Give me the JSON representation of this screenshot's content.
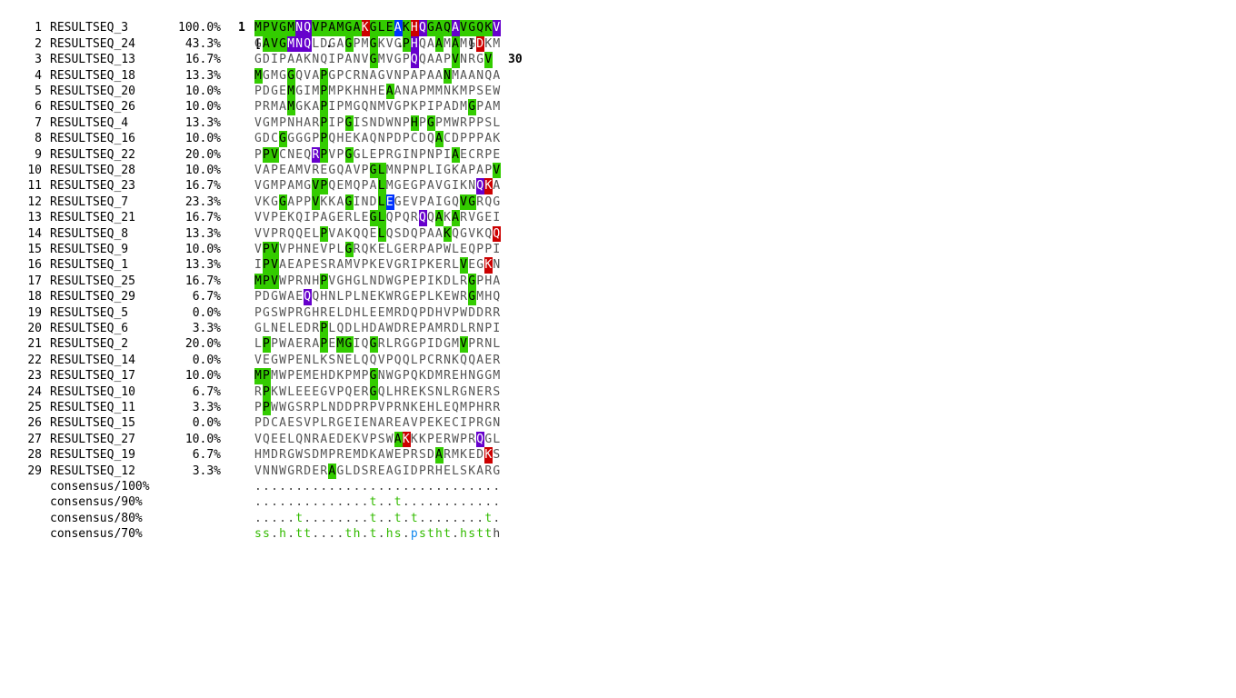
{
  "ruler": {
    "start": "1",
    "marks": "[         .         .         ]",
    "end": "30"
  },
  "colors": {
    "green": "#33cc00",
    "purple": "#6600cc",
    "red": "#cc0000",
    "blue": "#0033ff",
    "consensus_green": "#33bb00",
    "consensus_blue": "#1188ee"
  },
  "rows": [
    {
      "idx": "1",
      "name": "RESULTSEQ_3",
      "pct": "100.0%",
      "seq": "MPVGMNQVPAMGAKGLEAKHQGAQAVGQKV",
      "hl": "gggggppggggggrgggbgrpgggpggggprg"
    },
    {
      "idx": "2",
      "name": "RESULTSEQ_24",
      "pct": "43.3%",
      "seq": "GAVGMNQLDGAGPMGKVGPHQAAMAMGDKM",
      "hl": ".gggppp....g..g...gp..g.g..r."
    },
    {
      "idx": "3",
      "name": "RESULTSEQ_13",
      "pct": "16.7%",
      "seq": "GDIPAAKNQIPANVGMVGPQQAAPVNRGV",
      "hl": "..............g....p....g...g"
    },
    {
      "idx": "4",
      "name": "RESULTSEQ_18",
      "pct": "13.3%",
      "seq": "MGMGGQVAPGPCRNAGVNPAPAANMAANQA",
      "hl": "g...g...g..............g......"
    },
    {
      "idx": "5",
      "name": "RESULTSEQ_20",
      "pct": "10.0%",
      "seq": "PDGEMGIMPMPKHNHEAANAPMMNKMPSEW",
      "hl": "....g...g.......g............."
    },
    {
      "idx": "6",
      "name": "RESULTSEQ_26",
      "pct": "10.0%",
      "seq": "PRMAMGKAPIPMGQNMVGPKPIPADMGPAM",
      "hl": "....g...g.................g..."
    },
    {
      "idx": "7",
      "name": "RESULTSEQ_4",
      "pct": "13.3%",
      "seq": "VGMPNHARPIPGISNDWNPHPGPMWRPPSL",
      "hl": "........g..g.......g.g........"
    },
    {
      "idx": "8",
      "name": "RESULTSEQ_16",
      "pct": "10.0%",
      "seq": "GDCGGGGPPQHEKAQNPDPCDQACDPPPAK",
      "hl": "...g....g.............g......."
    },
    {
      "idx": "9",
      "name": "RESULTSEQ_22",
      "pct": "20.0%",
      "seq": "PPVCNEQRPVPGGLEPRGINPNPIAECRPE",
      "hl": ".gg....pg..g............g....."
    },
    {
      "idx": "10",
      "name": "RESULTSEQ_28",
      "pct": "10.0%",
      "seq": "VAPEAMVREGQAVPGLMNPNPLIGKAPAPV",
      "hl": "..............gg.............g"
    },
    {
      "idx": "11",
      "name": "RESULTSEQ_23",
      "pct": "16.7%",
      "seq": "VGMPAMGVPQEMQPALMGEGPAVGIKNQKA",
      "hl": ".......gg......g...........pr."
    },
    {
      "idx": "12",
      "name": "RESULTSEQ_7",
      "pct": "23.3%",
      "seq": "VKGGAPPVKKAGINDLEGEVPAIGQVGRQG",
      "hl": "...g...g...g...gb........gg..."
    },
    {
      "idx": "13",
      "name": "RESULTSEQ_21",
      "pct": "16.7%",
      "seq": "VVPEKQIPAGERLEGLQPQRQQAKARVGEI",
      "hl": "..............gg....p.g.g....."
    },
    {
      "idx": "14",
      "name": "RESULTSEQ_8",
      "pct": "13.3%",
      "seq": "VVPRQQELPVAKQQELQSDQPAAKQGVKQQ",
      "hl": "........g......g.......g.....r"
    },
    {
      "idx": "15",
      "name": "RESULTSEQ_9",
      "pct": "10.0%",
      "seq": "VPVVPHNEVPLGRQKELGERPAPWLEQPPI",
      "hl": ".gg........g.................."
    },
    {
      "idx": "16",
      "name": "RESULTSEQ_1",
      "pct": "13.3%",
      "seq": "IPVAEAPESRAMVPKEVGRIPKERLVEGKN",
      "hl": ".gg......................g..r."
    },
    {
      "idx": "17",
      "name": "RESULTSEQ_25",
      "pct": "16.7%",
      "seq": "MPVWPRNHPVGHGLNDWGPEPIKDLRGPHA",
      "hl": "ggg.....g.................g..."
    },
    {
      "idx": "18",
      "name": "RESULTSEQ_29",
      "pct": "6.7%",
      "seq": "PDGWAEQQHNLPLNEKWRGEPLKEWRGMHQ",
      "hl": "......p...................g..."
    },
    {
      "idx": "19",
      "name": "RESULTSEQ_5",
      "pct": "0.0%",
      "seq": "PGSWPRGHRELDHLEEMRDQPDHVPWDDRR",
      "hl": ".............................."
    },
    {
      "idx": "20",
      "name": "RESULTSEQ_6",
      "pct": "3.3%",
      "seq": "GLNELEDRPLQDLHDAWDREPAMRDLRNPI",
      "hl": "........g....................."
    },
    {
      "idx": "21",
      "name": "RESULTSEQ_2",
      "pct": "20.0%",
      "seq": "LPPWAERAPEMGIQGRLRGGPIDGMVPRNL",
      "hl": ".g......g.gg..g..........g...."
    },
    {
      "idx": "22",
      "name": "RESULTSEQ_14",
      "pct": "0.0%",
      "seq": "VEGWPENLKSNELQQVPQQLPCRNKQQAER",
      "hl": ".............................."
    },
    {
      "idx": "23",
      "name": "RESULTSEQ_17",
      "pct": "10.0%",
      "seq": "MPMWPEMEHDKPMPGNWGPQKDMREHNGGM",
      "hl": "gg............g..............."
    },
    {
      "idx": "24",
      "name": "RESULTSEQ_10",
      "pct": "6.7%",
      "seq": "RPKWLEEEGVPQERGQLHREKSNLRGNERS",
      "hl": ".g............g..............."
    },
    {
      "idx": "25",
      "name": "RESULTSEQ_11",
      "pct": "3.3%",
      "seq": "PPWWGSRPLNDDPRPVPRNKEHLEQMPHRR",
      "hl": ".g............................"
    },
    {
      "idx": "26",
      "name": "RESULTSEQ_15",
      "pct": "0.0%",
      "seq": "PDCAESVPLRGEIENAREAVPEKECIPRGN",
      "hl": ".............................."
    },
    {
      "idx": "27",
      "name": "RESULTSEQ_27",
      "pct": "10.0%",
      "seq": "VQEELQNRAEDEKVPSWAKKKPERWPRQGL",
      "hl": ".................gr........p.."
    },
    {
      "idx": "28",
      "name": "RESULTSEQ_19",
      "pct": "6.7%",
      "seq": "HMDRGWSDMPREMDKAWEPRSDARMKEDKS",
      "hl": "......................g.....r."
    },
    {
      "idx": "29",
      "name": "RESULTSEQ_12",
      "pct": "3.3%",
      "seq": "VNNWGRDERAGLDSREAGIDPRHELSKARG",
      "hl": ".........g...................."
    }
  ],
  "consensus": [
    {
      "name": "consensus/100%",
      "seq": "..............................",
      "hl": "............................."
    },
    {
      "name": "consensus/90%",
      "seq": "..............t..t............",
      "hl": "..............g..g............"
    },
    {
      "name": "consensus/80%",
      "seq": ".....t........t..t.t........t.",
      "hl": ".....g........g..g.g........g."
    },
    {
      "name": "consensus/70%",
      "seq": "ss.h.tt....th.t.hs.pstht.hstth",
      "hl": "gg.g.gg....gg.g.gg.bgggg.gggg"
    }
  ]
}
